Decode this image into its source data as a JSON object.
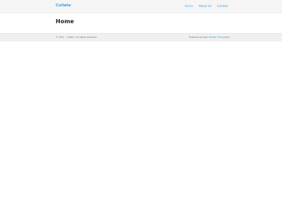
{
  "header": {
    "brand": "Collate",
    "nav": [
      {
        "label": "Home",
        "active": true
      },
      {
        "label": "About Us",
        "active": false
      },
      {
        "label": "Contact",
        "active": false
      }
    ]
  },
  "main": {
    "title": "Home"
  },
  "footer": {
    "copyright": "© 2022 - Collate. All rights reserved",
    "powered_prefix": "Powered by",
    "powered_link": "Page Builder Framework"
  },
  "colors": {
    "accent": "#3aa0dc",
    "header_bg": "#f5f5f5",
    "footer_bg": "#f0f0f0",
    "title": "#222222"
  }
}
